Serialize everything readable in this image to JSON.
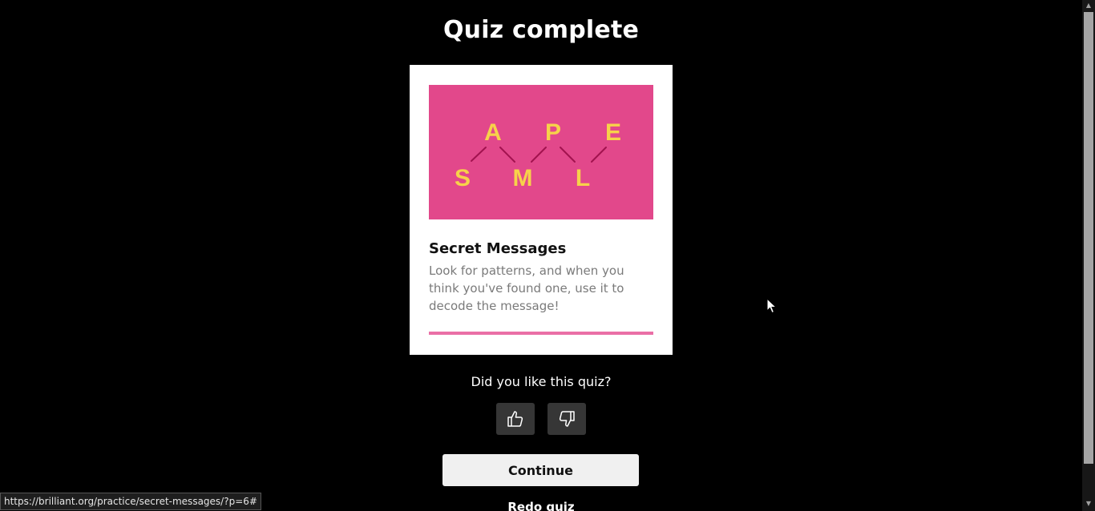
{
  "page": {
    "title": "Quiz complete"
  },
  "card": {
    "image": {
      "background": "#e2488b",
      "letter_color": "#f7d24a",
      "line_color": "#a2124f",
      "top_letters": [
        "A",
        "P",
        "E"
      ],
      "bottom_letters": [
        "S",
        "M",
        "L"
      ]
    },
    "title": "Secret Messages",
    "description": "Look for patterns, and when you think you've found one, use it to decode the message!",
    "progress": 1.0,
    "progress_color": "#ea6fa6"
  },
  "feedback": {
    "question": "Did you like this quiz?",
    "like_icon": "thumbs-up-icon",
    "dislike_icon": "thumbs-down-icon"
  },
  "actions": {
    "continue_label": "Continue",
    "redo_label": "Redo quiz"
  },
  "status_bar": {
    "url": "https://brilliant.org/practice/secret-messages/?p=6#"
  }
}
